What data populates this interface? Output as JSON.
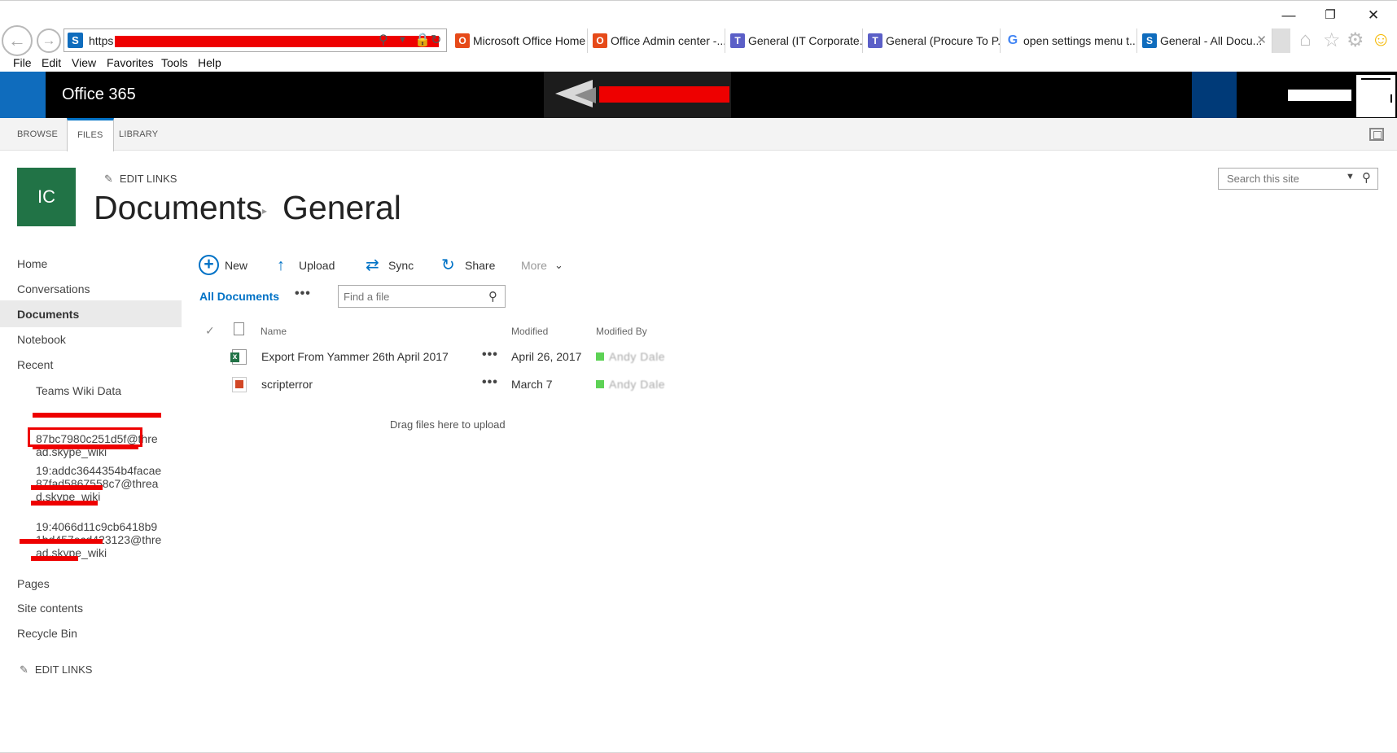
{
  "browser": {
    "address": {
      "url_prefix": "https"
    },
    "tabs": [
      {
        "label": "Microsoft Office Home",
        "icon": "office-icon",
        "bg": "#d9a8d6",
        "icon_bg": "#e64a19"
      },
      {
        "label": "Office Admin center -...",
        "icon": "office-icon",
        "bg": "#d9a8d6",
        "icon_bg": "#e64a19"
      },
      {
        "label": "General (IT Corporate...",
        "icon": "teams-icon",
        "bg": "#f5c400",
        "icon_bg": "#5b5fc7"
      },
      {
        "label": "General (Procure To P...",
        "icon": "teams-icon",
        "bg": "#f0f0f0",
        "icon_bg": "#5b5fc7"
      },
      {
        "label": "open settings menu t...",
        "icon": "google-icon",
        "bg": "#f0f0f0",
        "icon_bg": "#4285f4"
      },
      {
        "label": "General - All Docu...",
        "icon": "sharepoint-icon",
        "bg": "#ffffff",
        "icon_bg": "#0f6cbd"
      }
    ],
    "menu": [
      "File",
      "Edit",
      "View",
      "Favorites",
      "Tools",
      "Help"
    ]
  },
  "suite": {
    "title": "Office 365"
  },
  "ribbon": {
    "tabs": [
      "BROWSE",
      "FILES",
      "LIBRARY"
    ],
    "active": "FILES"
  },
  "site": {
    "logo_text": "IC",
    "edit_links": "EDIT LINKS",
    "title_parent": "Documents",
    "title_current": "General",
    "search_placeholder": "Search this site"
  },
  "left_nav": {
    "home": "Home",
    "conversations": "Conversations",
    "documents": "Documents",
    "notebook": "Notebook",
    "recent": "Recent",
    "recent_items": [
      {
        "text": "Teams Wiki Data"
      },
      {
        "line2": "87bc7980c251d5f@thre",
        "line3": "ad.skype_wiki"
      },
      {
        "line1": "19:addc3644354b4facae",
        "line2": "87fad5867558c7@threa",
        "line3": "d.skype_wiki"
      },
      {
        "line1": "19:4066d11c9cb6418b9",
        "line2": "1bd457ecd423123@thre",
        "line3": "ad.skype_wiki"
      }
    ],
    "pages": "Pages",
    "site_contents": "Site contents",
    "recycle_bin": "Recycle Bin",
    "edit_links": "EDIT LINKS"
  },
  "commands": {
    "new": "New",
    "upload": "Upload",
    "sync": "Sync",
    "share": "Share",
    "more": "More"
  },
  "view": {
    "name": "All Documents",
    "ellipsis": "•••",
    "find_placeholder": "Find a file"
  },
  "list": {
    "columns": {
      "name": "Name",
      "modified": "Modified",
      "modified_by": "Modified By"
    },
    "rows": [
      {
        "name": "Export From Yammer 26th April 2017",
        "type": "excel-file-icon",
        "modified": "April 26, 2017",
        "modified_by": "Andy Dale"
      },
      {
        "name": "scripterror",
        "type": "image-file-icon",
        "modified": "March 7",
        "modified_by": "Andy Dale"
      }
    ],
    "drop_hint": "Drag files here to upload"
  },
  "colors": {
    "accent": "#0072c6",
    "suite_bar": "#000000",
    "site_logo": "#217346",
    "presence": "#5dd255"
  }
}
